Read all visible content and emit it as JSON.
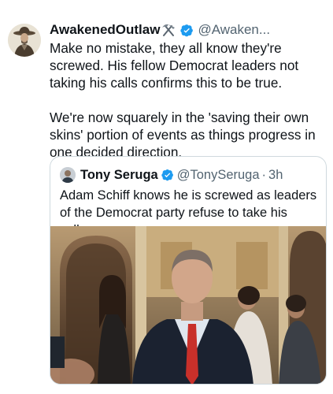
{
  "tweet": {
    "author_name": "AwakenedOutlaw",
    "author_handle": "@Awaken...",
    "name_emoji_icon": "hammer-and-pick-icon",
    "verified_icon": "verified-badge-icon",
    "text": "Make no mistake, they all know they're screwed. His fellow Democrat leaders not taking his calls confirms this to be true.\n\nWe're now squarely in the 'saving their own skins' portion of events as things progress in one decided direction."
  },
  "quote": {
    "author_name": "Tony Seruga",
    "author_handle": "@TonySeruga",
    "separator": "·",
    "time": "3h",
    "text": "Adam Schiff knows he is screwed as leaders of the Democrat party refuse to take his calls.",
    "media_icon": "news-photo-image"
  },
  "colors": {
    "text": "#0f1419",
    "secondary": "#536471",
    "verified": "#1d9bf0",
    "border": "#cfd9de"
  }
}
